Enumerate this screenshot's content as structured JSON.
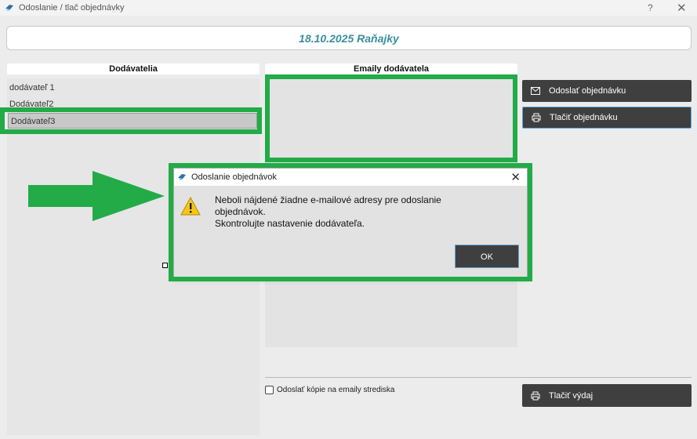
{
  "window": {
    "title": "Odoslanie / tlač objednávky",
    "help": "?",
    "close": "✕"
  },
  "header": {
    "date_location": "18.10.2025 Raňajky"
  },
  "suppliers": {
    "title": "Dodávatelia",
    "items": [
      {
        "label": "dodávateľ 1",
        "selected": false
      },
      {
        "label": "Dodávateľ2",
        "selected": false
      },
      {
        "label": "Dodávateľ3",
        "selected": true
      }
    ]
  },
  "emails": {
    "title": "Emaily dodávatela",
    "items": []
  },
  "actions": {
    "send_order": "Odoslať objednávku",
    "print_order": "Tlačiť objednávku",
    "print_issue": "Tlačiť výdaj"
  },
  "copy_option": {
    "label": "Odoslať kópie na emaily strediska",
    "checked": false
  },
  "dialog": {
    "title": "Odoslanie objednávok",
    "close": "✕",
    "message_lines": [
      "Neboli nájdené žiadne e-mailové adresy pre odoslanie",
      "objednávok.",
      "Skontrolujte nastavenie dodávateľa."
    ],
    "ok_label": "OK"
  },
  "colors": {
    "highlight": "#22ab47",
    "accent_text": "#3a8fa0",
    "dark_button": "#3f3f3f"
  }
}
